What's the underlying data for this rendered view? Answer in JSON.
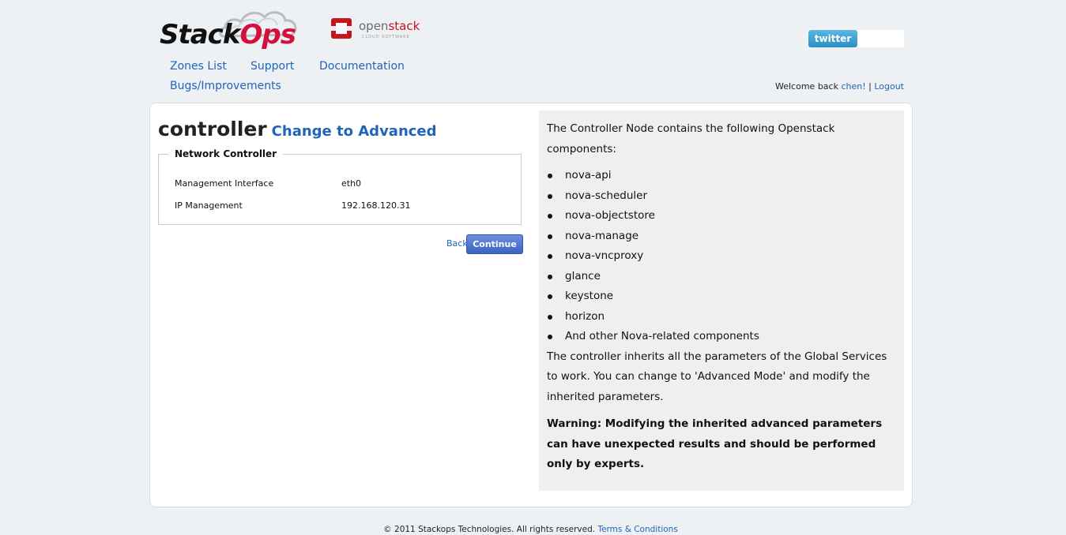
{
  "header": {
    "stackops_logo": {
      "part1": "Stack",
      "part2": "Ops"
    },
    "openstack_logo": {
      "name_part1": "open",
      "name_part2": "stack",
      "tagline": "CLOUD SOFTWARE"
    },
    "twitter_button": "twitter",
    "nav": [
      {
        "label": "Zones List"
      },
      {
        "label": "Support"
      },
      {
        "label": "Documentation"
      },
      {
        "label": "Bugs/Improvements"
      }
    ],
    "welcome": {
      "prefix": "Welcome back ",
      "user": "chen!",
      "separator": " | ",
      "logout": "Logout"
    }
  },
  "main": {
    "title": "controller",
    "advanced_link": "Change to Advanced",
    "fieldset": {
      "legend": "Network Controller",
      "rows": [
        {
          "label": "Management Interface",
          "value": "eth0"
        },
        {
          "label": "IP Management",
          "value": "192.168.120.31"
        }
      ]
    },
    "back_label": "Back",
    "continue_label": "Continue"
  },
  "info": {
    "intro": "The Controller Node contains the following Openstack components:",
    "components": [
      "nova-api",
      "nova-scheduler",
      "nova-objectstore",
      "nova-manage",
      "nova-vncproxy",
      "glance",
      "keystone",
      "horizon",
      "And other Nova-related components"
    ],
    "inherit": "The controller inherits all the parameters of the Global Services to work. You can change to 'Advanced Mode' and modify the inherited parameters.",
    "warning": "Warning: Modifying the inherited advanced parameters can have unexpected results and should be performed only by experts."
  },
  "footer": {
    "copyright": "© 2011 Stackops Technologies. All rights reserved. ",
    "terms": "Terms & Conditions"
  },
  "colors": {
    "link": "#1e64b9",
    "brand_red": "#d3103c",
    "continue_button": "#3a63c4",
    "twitter": "#2a8ec5"
  }
}
